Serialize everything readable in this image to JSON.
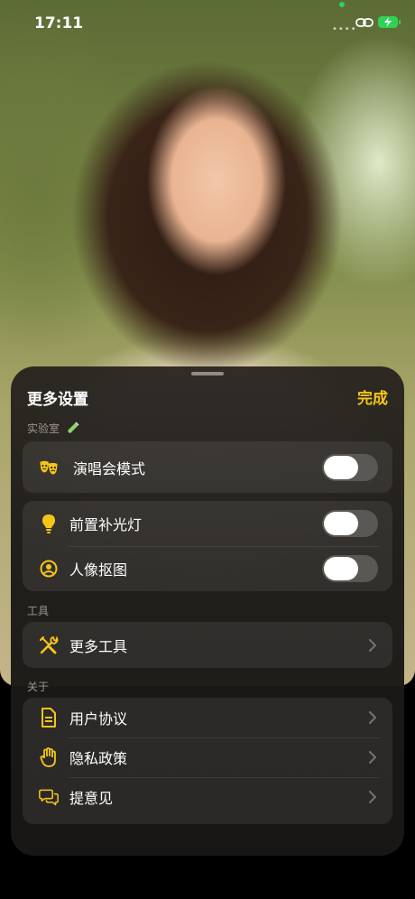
{
  "status": {
    "time": "17:11",
    "signal": "••••"
  },
  "sheet": {
    "title": "更多设置",
    "done_label": "完成"
  },
  "sections": {
    "lab": {
      "label": "实验室",
      "items": [
        {
          "label": "演唱会模式",
          "icon": "theater-masks-icon",
          "toggle": false
        }
      ],
      "items2": [
        {
          "label": "前置补光灯",
          "icon": "lightbulb-icon",
          "toggle": false
        },
        {
          "label": "人像抠图",
          "icon": "portrait-icon",
          "toggle": false
        }
      ]
    },
    "tools": {
      "label": "工具",
      "items": [
        {
          "label": "更多工具",
          "icon": "tools-icon"
        }
      ]
    },
    "about": {
      "label": "关于",
      "items": [
        {
          "label": "用户协议",
          "icon": "document-icon"
        },
        {
          "label": "隐私政策",
          "icon": "hand-icon"
        },
        {
          "label": "提意见",
          "icon": "chat-bubbles-icon"
        }
      ]
    }
  },
  "colors": {
    "accent": "#f5c518",
    "battery": "#31d158"
  }
}
